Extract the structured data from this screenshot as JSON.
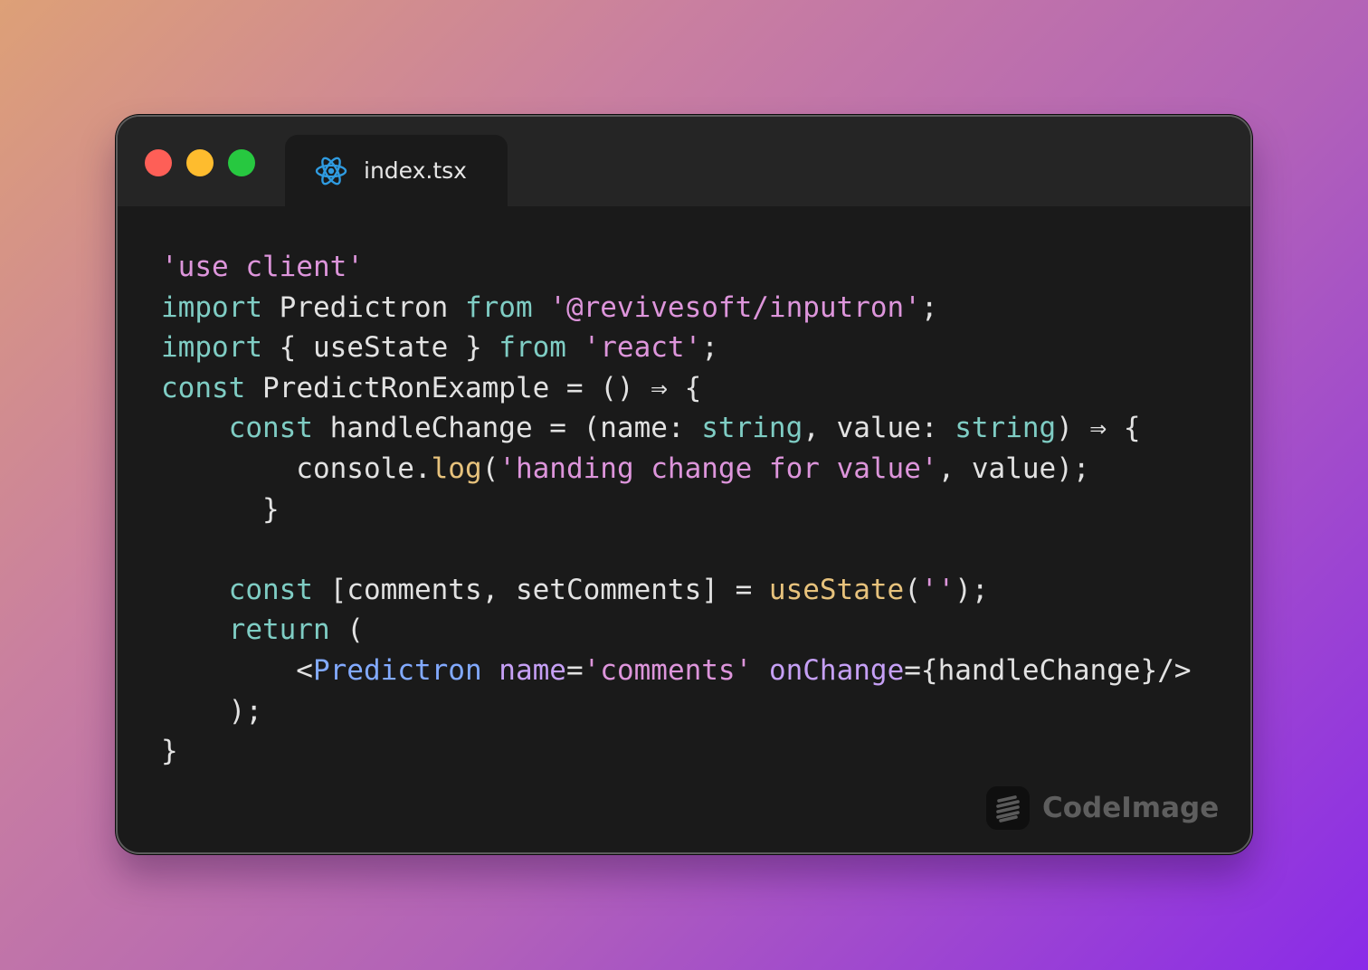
{
  "window": {
    "controls": {
      "close_color": "#fe5f57",
      "minimize_color": "#febc2e",
      "maximize_color": "#27c840"
    },
    "tab": {
      "filename": "index.tsx",
      "icon": "react-icon"
    }
  },
  "code": {
    "language": "tsx",
    "lines": [
      [
        {
          "t": "'use client'",
          "c": "str"
        }
      ],
      [
        {
          "t": "import",
          "c": "kw"
        },
        {
          "t": " Predictron ",
          "c": "pl"
        },
        {
          "t": "from",
          "c": "kw"
        },
        {
          "t": " ",
          "c": "pl"
        },
        {
          "t": "'@revivesoft/inputron'",
          "c": "str"
        },
        {
          "t": ";",
          "c": "pl"
        }
      ],
      [
        {
          "t": "import",
          "c": "kw"
        },
        {
          "t": " { useState } ",
          "c": "pl"
        },
        {
          "t": "from",
          "c": "kw"
        },
        {
          "t": " ",
          "c": "pl"
        },
        {
          "t": "'react'",
          "c": "str"
        },
        {
          "t": ";",
          "c": "pl"
        }
      ],
      [
        {
          "t": "const",
          "c": "kw"
        },
        {
          "t": " PredictRonExample = () ⇒ {",
          "c": "pl"
        }
      ],
      [
        {
          "t": "    ",
          "c": "pl"
        },
        {
          "t": "const",
          "c": "kw"
        },
        {
          "t": " handleChange = (name: ",
          "c": "pl"
        },
        {
          "t": "string",
          "c": "kw"
        },
        {
          "t": ", value: ",
          "c": "pl"
        },
        {
          "t": "string",
          "c": "kw"
        },
        {
          "t": ") ⇒ {",
          "c": "pl"
        }
      ],
      [
        {
          "t": "        console.",
          "c": "pl"
        },
        {
          "t": "log",
          "c": "fn"
        },
        {
          "t": "(",
          "c": "pl"
        },
        {
          "t": "'handing change for value'",
          "c": "str"
        },
        {
          "t": ", value);",
          "c": "pl"
        }
      ],
      [
        {
          "t": "      }",
          "c": "pl"
        }
      ],
      [],
      [
        {
          "t": "    ",
          "c": "pl"
        },
        {
          "t": "const",
          "c": "kw"
        },
        {
          "t": " [comments, setComments] = ",
          "c": "pl"
        },
        {
          "t": "useState",
          "c": "fn"
        },
        {
          "t": "(",
          "c": "pl"
        },
        {
          "t": "''",
          "c": "str"
        },
        {
          "t": ");",
          "c": "pl"
        }
      ],
      [
        {
          "t": "    ",
          "c": "pl"
        },
        {
          "t": "return",
          "c": "kw"
        },
        {
          "t": " (",
          "c": "pl"
        }
      ],
      [
        {
          "t": "        <",
          "c": "pl"
        },
        {
          "t": "Predictron",
          "c": "tag"
        },
        {
          "t": " ",
          "c": "pl"
        },
        {
          "t": "name",
          "c": "attr"
        },
        {
          "t": "=",
          "c": "pl"
        },
        {
          "t": "'comments'",
          "c": "str"
        },
        {
          "t": " ",
          "c": "pl"
        },
        {
          "t": "onChange",
          "c": "attr"
        },
        {
          "t": "={handleChange}/>",
          "c": "pl"
        }
      ],
      [
        {
          "t": "    );",
          "c": "pl"
        }
      ],
      [
        {
          "t": "}",
          "c": "pl"
        }
      ]
    ]
  },
  "watermark": {
    "label": "CodeImage",
    "icon": "codeimage-logo-icon"
  }
}
